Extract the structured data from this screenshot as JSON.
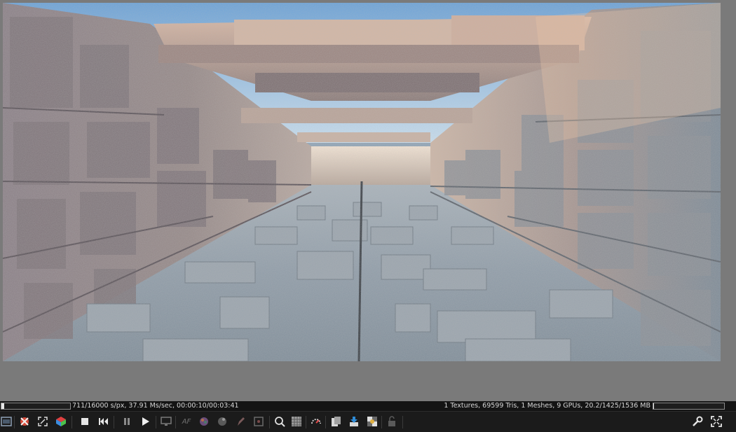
{
  "status": {
    "render_progress": 0.044,
    "left_text": "711/16000 s/px, 37.91 Ms/sec, 00:00:10/00:03:41",
    "right_text": "1 Textures, 69599 Tris, 1 Meshes, 9 GPUs, 20.2/1425/1536 MB",
    "gpu_memory_fraction": 0.013
  },
  "toolbar": {
    "icons": [
      "film-icon",
      "mesh-picker-icon",
      "region-icon",
      "cube-icon",
      "stop-icon",
      "restart-icon",
      "pause-icon",
      "play-icon",
      "monitor-icon",
      "af-icon",
      "color-picker-icon",
      "material-icon",
      "pen-icon",
      "focus-icon",
      "zoom-icon",
      "grid-icon",
      "dial-icon",
      "clipboard-icon",
      "export-icon",
      "texture-icon",
      "lock-icon",
      "wrench-icon",
      "fullscreen-icon"
    ],
    "af_label": "AF"
  }
}
